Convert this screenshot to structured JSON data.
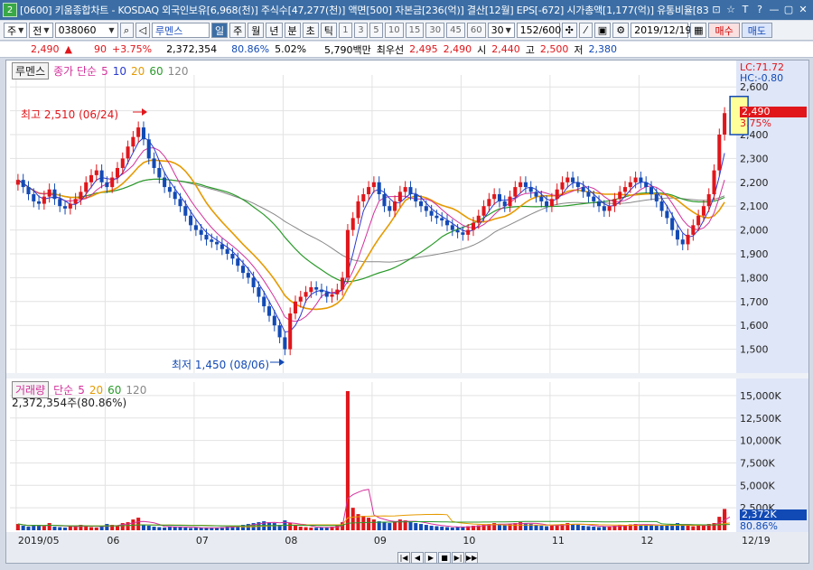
{
  "window": {
    "badge": "2",
    "title": "[0600] 키움종합차트 - KOSDAQ 외국인보유[6,968(천)] 주식수[47,277(천)] 액면[500] 자본금[236(억)] 결산[12월] EPS[-672] 시가총액[1,177(억)] 유통비율[83",
    "buttons": [
      "⊡",
      "☆",
      "T",
      "?",
      "—",
      "▢",
      "✕"
    ]
  },
  "toolbar": {
    "period_label": "주",
    "range_label": "전",
    "code": "038060",
    "stock_name": "루멘스",
    "timeframes": [
      "일",
      "주",
      "월",
      "년",
      "분",
      "초",
      "틱"
    ],
    "active_timeframe": "일",
    "intervals": [
      "1",
      "3",
      "5",
      "10",
      "15",
      "30",
      "45",
      "60"
    ],
    "interval_select": "30",
    "count": "152",
    "count_total": "/600",
    "date": "2019/12/19",
    "buy_label": "매수",
    "sell_label": "매도"
  },
  "quote": {
    "price": "2,490",
    "change": "90",
    "change_pct": "+3.75%",
    "volume": "2,372,354",
    "vol_ratio": "80.86%",
    "turnover": "5.02%",
    "amount": "5,790백만",
    "best_ask_label": "최우선",
    "best_ask": "2,495",
    "best_bid": "2,490",
    "open_label": "시",
    "open": "2,440",
    "high_label": "고",
    "high": "2,500",
    "low_label": "저",
    "low": "2,380"
  },
  "price_panel": {
    "name": "루멘스",
    "ma_label": "종가 단순",
    "ma_periods": [
      "5",
      "10",
      "20",
      "60",
      "120"
    ],
    "lc_label": "LC:71.72",
    "hc_label": "HC:-0.80",
    "high_annot": "최고 2,510 (06/24)",
    "low_annot": "최저 1,450 (08/06)",
    "last_price_tag": "2,490",
    "last_pct_tag": "3.75%"
  },
  "volume_panel": {
    "name": "거래량",
    "ma_label": "단순",
    "ma_periods": [
      "5",
      "20",
      "60",
      "120"
    ],
    "current": "2,372,354주(80.86%)",
    "last_tag": "2,372K",
    "last_pct_tag": "80.86%"
  },
  "colors": {
    "up": "#e0161b",
    "down": "#124ab5",
    "ma5": "#2a3ad0",
    "ma10": "#d4329c",
    "ma20": "#e69a00",
    "ma60": "#2a9a2a",
    "ma120": "#888888"
  },
  "chart_data": [
    {
      "type": "candlestick",
      "title": "루멘스",
      "x": [
        "2019/05",
        "06",
        "07",
        "08",
        "09",
        "10",
        "11",
        "12",
        "12/19"
      ],
      "y_ticks": [
        1500,
        1600,
        1700,
        1800,
        1900,
        2000,
        2100,
        2200,
        2300,
        2400,
        2500,
        2600
      ],
      "ylim": [
        1400,
        2650
      ],
      "grid": true,
      "closes": [
        2210,
        2180,
        2150,
        2120,
        2110,
        2140,
        2170,
        2130,
        2100,
        2090,
        2110,
        2130,
        2160,
        2200,
        2230,
        2250,
        2200,
        2180,
        2220,
        2260,
        2300,
        2350,
        2390,
        2430,
        2380,
        2300,
        2260,
        2220,
        2180,
        2160,
        2130,
        2100,
        2060,
        2020,
        2000,
        1980,
        1960,
        1950,
        1940,
        1920,
        1900,
        1880,
        1850,
        1820,
        1800,
        1760,
        1720,
        1680,
        1640,
        1600,
        1550,
        1500,
        1650,
        1700,
        1720,
        1740,
        1760,
        1750,
        1740,
        1720,
        1730,
        1750,
        1800,
        2000,
        2050,
        2120,
        2150,
        2180,
        2200,
        2150,
        2100,
        2080,
        2120,
        2160,
        2180,
        2150,
        2120,
        2100,
        2080,
        2060,
        2050,
        2040,
        2020,
        2000,
        1990,
        1980,
        2000,
        2030,
        2060,
        2100,
        2130,
        2150,
        2120,
        2100,
        2140,
        2180,
        2200,
        2180,
        2160,
        2140,
        2120,
        2100,
        2130,
        2170,
        2200,
        2220,
        2200,
        2180,
        2160,
        2140,
        2120,
        2100,
        2080,
        2100,
        2130,
        2160,
        2180,
        2200,
        2220,
        2200,
        2180,
        2150,
        2120,
        2080,
        2050,
        2000,
        1960,
        1940,
        1980,
        2020,
        2060,
        2100,
        2150,
        2250,
        2400,
        2490
      ],
      "annotations": [
        "최고 2,510 (06/24)",
        "최저 1,450 (08/06)"
      ],
      "last": 2490
    },
    {
      "type": "bar",
      "title": "거래량",
      "y_ticks": [
        2500,
        5000,
        7500,
        10000,
        12500,
        15000
      ],
      "y_unit": "K",
      "ylim": [
        0,
        16500
      ],
      "values": [
        700,
        500,
        400,
        600,
        500,
        450,
        800,
        400,
        350,
        300,
        450,
        500,
        600,
        400,
        350,
        300,
        500,
        700,
        600,
        500,
        800,
        900,
        1200,
        1400,
        600,
        500,
        400,
        350,
        300,
        450,
        400,
        350,
        300,
        250,
        300,
        280,
        260,
        250,
        300,
        350,
        400,
        450,
        500,
        600,
        700,
        800,
        900,
        1000,
        900,
        800,
        600,
        1100,
        800,
        500,
        400,
        350,
        300,
        280,
        300,
        350,
        400,
        500,
        900,
        15500,
        2500,
        1800,
        1600,
        1400,
        1200,
        1000,
        900,
        800,
        1000,
        1200,
        1100,
        900,
        800,
        700,
        600,
        500,
        450,
        400,
        350,
        300,
        350,
        400,
        450,
        500,
        550,
        600,
        700,
        800,
        700,
        600,
        700,
        800,
        900,
        800,
        700,
        600,
        500,
        450,
        500,
        600,
        700,
        800,
        700,
        600,
        500,
        450,
        400,
        350,
        400,
        450,
        500,
        550,
        600,
        650,
        700,
        650,
        600,
        550,
        500,
        500,
        600,
        700,
        800,
        600,
        500,
        450,
        500,
        600,
        700,
        800,
        1500,
        2000,
        2372
      ]
    }
  ]
}
